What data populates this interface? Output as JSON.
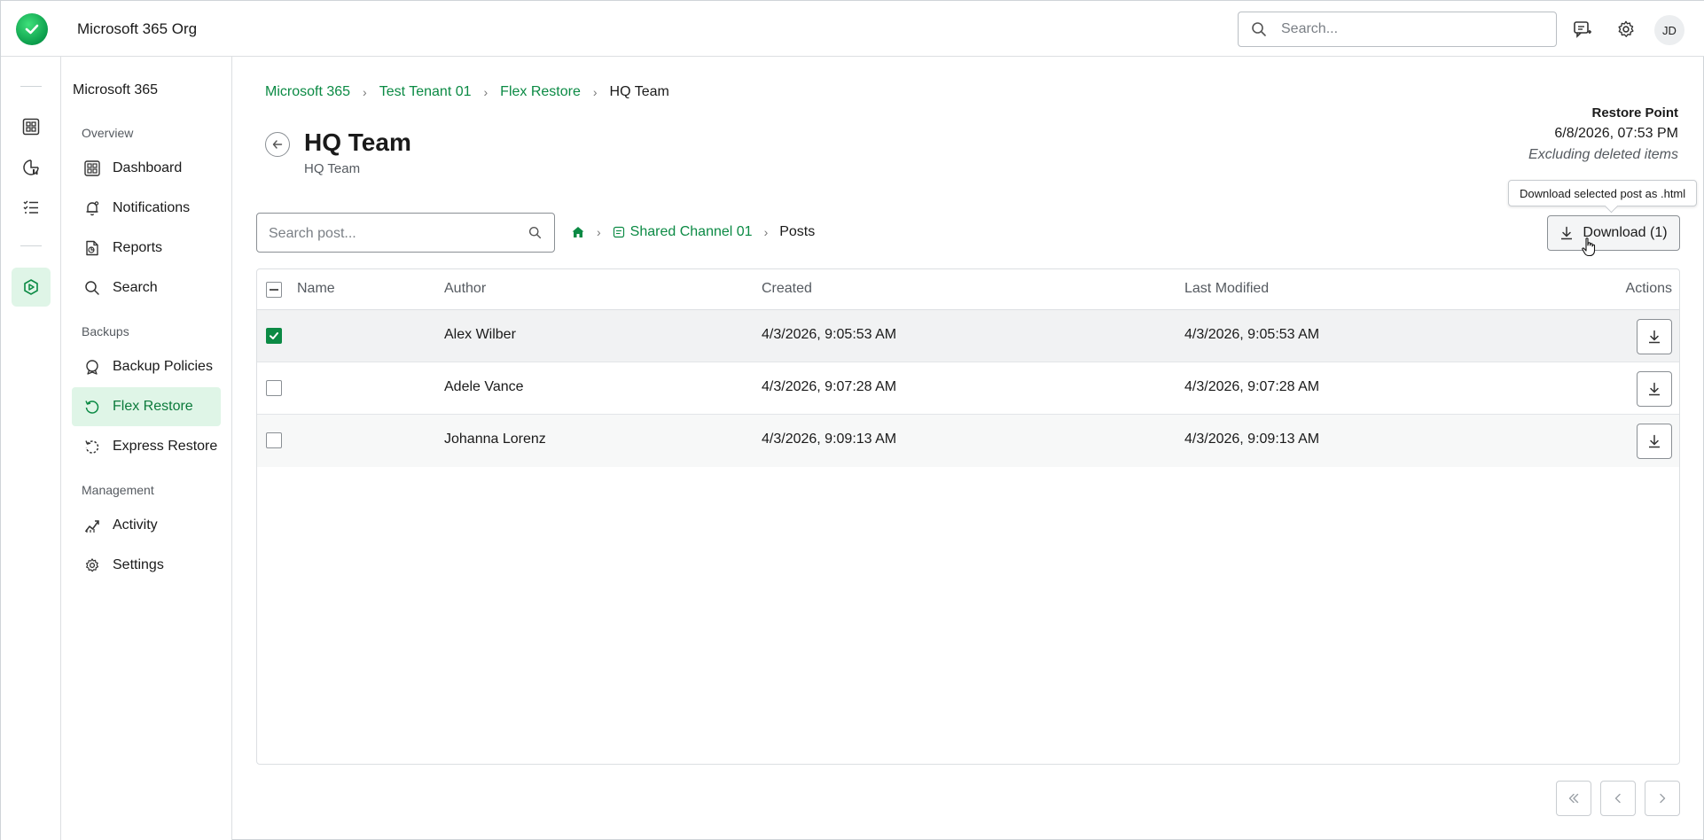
{
  "app": {
    "org_title": "Microsoft 365 Org",
    "search_placeholder": "Search...",
    "avatar_initials": "JD",
    "accent_color": "#0b8a44"
  },
  "nav": {
    "title": "Microsoft 365",
    "sections": {
      "overview": "Overview",
      "backups": "Backups",
      "management": "Management"
    },
    "items": [
      {
        "label": "Dashboard",
        "icon": "dashboard-icon"
      },
      {
        "label": "Notifications",
        "icon": "bell-icon"
      },
      {
        "label": "Reports",
        "icon": "report-icon"
      },
      {
        "label": "Search",
        "icon": "search-icon"
      },
      {
        "label": "Backup Policies",
        "icon": "policy-icon"
      },
      {
        "label": "Flex Restore",
        "icon": "restore-icon",
        "active": true
      },
      {
        "label": "Express Restore",
        "icon": "express-restore-icon"
      },
      {
        "label": "Activity",
        "icon": "activity-icon"
      },
      {
        "label": "Settings",
        "icon": "gear-icon"
      }
    ]
  },
  "breadcrumb": [
    {
      "label": "Microsoft 365"
    },
    {
      "label": "Test Tenant 01"
    },
    {
      "label": "Flex Restore"
    },
    {
      "label": "HQ Team"
    }
  ],
  "page": {
    "title": "HQ Team",
    "subtitle": "HQ Team"
  },
  "restore_point": {
    "label": "Restore Point",
    "datetime": "6/8/2026, 07:53 PM",
    "note": "Excluding deleted items"
  },
  "toolbar": {
    "search_placeholder": "Search post...",
    "path": {
      "channel": "Shared Channel 01",
      "current": "Posts"
    },
    "tooltip": "Download selected post as .html",
    "download_label": "Download (1)"
  },
  "table": {
    "columns": [
      "Name",
      "Author",
      "Created",
      "Last Modified",
      "Actions"
    ],
    "rows": [
      {
        "name": "",
        "author": "Alex Wilber",
        "created": "4/3/2026, 9:05:53 AM",
        "modified": "4/3/2026, 9:05:53 AM",
        "checked": true
      },
      {
        "name": "",
        "author": "Adele Vance",
        "created": "4/3/2026, 9:07:28 AM",
        "modified": "4/3/2026, 9:07:28 AM",
        "checked": false
      },
      {
        "name": "",
        "author": "Johanna Lorenz",
        "created": "4/3/2026, 9:09:13 AM",
        "modified": "4/3/2026, 9:09:13 AM",
        "checked": false
      }
    ]
  }
}
